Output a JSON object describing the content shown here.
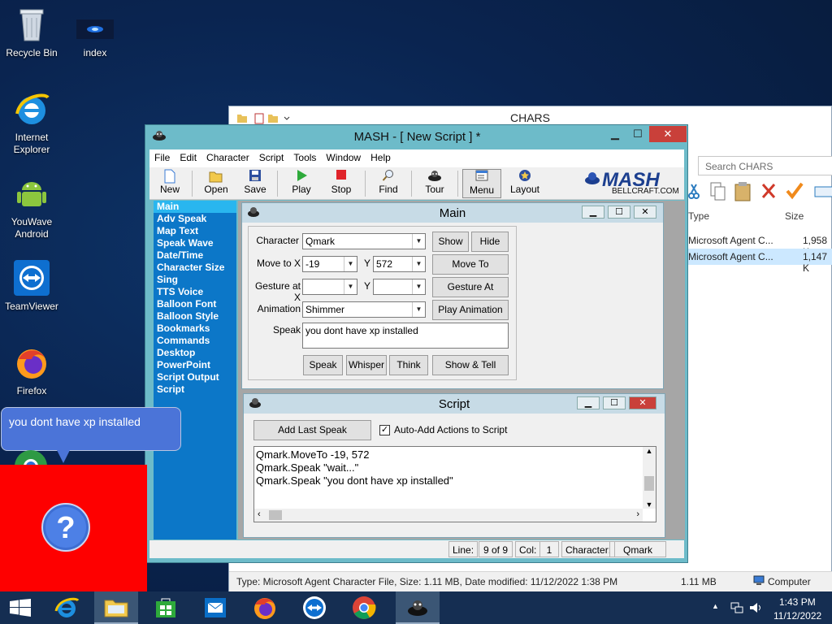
{
  "desktop": {
    "icons": [
      {
        "label": "Recycle Bin"
      },
      {
        "label": "index"
      },
      {
        "label": "Internet Explorer"
      },
      {
        "label": "YouWave Android"
      },
      {
        "label": "TeamViewer"
      },
      {
        "label": "Firefox"
      }
    ]
  },
  "explorer": {
    "title": "CHARS",
    "search_placeholder": "Search CHARS",
    "columns": {
      "type": "Type",
      "size": "Size"
    },
    "rows": [
      {
        "type": "Microsoft Agent C...",
        "size": "1,958 K"
      },
      {
        "type": "Microsoft Agent C...",
        "size": "1,147 K"
      }
    ],
    "status": {
      "info": "Type: Microsoft Agent Character File, Size: 1.11 MB, Date modified: 11/12/2022 1:38 PM",
      "size": "1.11 MB",
      "location": "Computer"
    }
  },
  "mash": {
    "title": "MASH - [ New Script ] *",
    "menu": [
      "File",
      "Edit",
      "Character",
      "Script",
      "Tools",
      "Window",
      "Help"
    ],
    "toolbar": [
      "New",
      "Open",
      "Save",
      "Play",
      "Stop",
      "Find",
      "Tour",
      "Menu",
      "Layout"
    ],
    "logo_text": "MASH",
    "logo_sub": "BELLCRAFT.COM",
    "sidebar": [
      "Main",
      "Adv Speak",
      "Map Text",
      "Speak Wave",
      "Date/Time",
      "Character Size",
      "Sing",
      "TTS Voice",
      "Balloon Font",
      "Balloon Style",
      "Bookmarks",
      "Commands",
      "Desktop",
      "PowerPoint",
      "Script Output",
      "Script"
    ],
    "main": {
      "title": "Main",
      "character_label": "Character",
      "character_value": "Qmark",
      "show_btn": "Show",
      "hide_btn": "Hide",
      "moveto_label": "Move to X",
      "moveto_x": "-19",
      "y_label": "Y",
      "moveto_y": "572",
      "moveto_btn": "Move To",
      "gesture_label": "Gesture at X",
      "gesture_btn": "Gesture At",
      "animation_label": "Animation",
      "animation_value": "Shimmer",
      "play_anim_btn": "Play Animation",
      "speak_label": "Speak",
      "speak_value": "you dont have xp installed",
      "speak_btn": "Speak",
      "whisper_btn": "Whisper",
      "think_btn": "Think",
      "showtell_btn": "Show & Tell"
    },
    "script": {
      "title": "Script",
      "add_last_speak": "Add Last Speak",
      "auto_add": "Auto-Add Actions to Script",
      "lines": [
        "Qmark.MoveTo -19, 572",
        "Qmark.Speak \"wait...\"",
        "Qmark.Speak \"you dont have xp installed\""
      ]
    },
    "status": {
      "line_label": "Line:",
      "line_value": "9 of 9",
      "col_label": "Col:",
      "col_value": "1",
      "char_label": "Character:",
      "char_value": "Qmark"
    }
  },
  "balloon": {
    "text": "you dont have xp installed"
  },
  "taskbar": {
    "time": "1:43 PM",
    "date": "11/12/2022"
  }
}
